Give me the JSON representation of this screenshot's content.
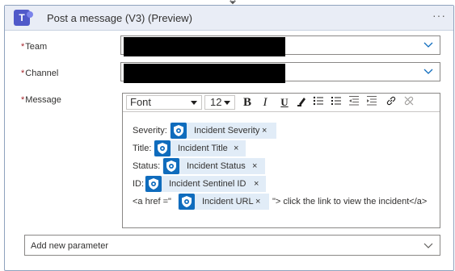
{
  "action": {
    "title": "Post a message (V3) (Preview)",
    "more_label": "···",
    "logo_letter": "T"
  },
  "fields": {
    "team_label": "Team",
    "channel_label": "Channel",
    "message_label": "Message",
    "required_marker": "*"
  },
  "toolbar": {
    "font": "Font",
    "size": "12",
    "bold": "B",
    "italic": "I",
    "underline": "U"
  },
  "message": {
    "severity_label": "Severity:",
    "severity_token": "Incident Severity",
    "title_label": "Title:",
    "title_token": "Incident Title",
    "status_label": "Status:",
    "status_token": "Incident Status",
    "id_label": "ID:",
    "id_token": "Incident Sentinel ID",
    "href_prefix": "<a href =\"",
    "url_token": "Incident URL",
    "href_suffix": "\"> click the link to view the incident</a>",
    "remove_glyph": "×"
  },
  "add_parameter": {
    "label": "Add new parameter"
  },
  "colors": {
    "accent": "#0f6cbd",
    "token_bg": "#e1ecf7",
    "header_bg": "#e9edf6",
    "required": "#a4262c"
  }
}
